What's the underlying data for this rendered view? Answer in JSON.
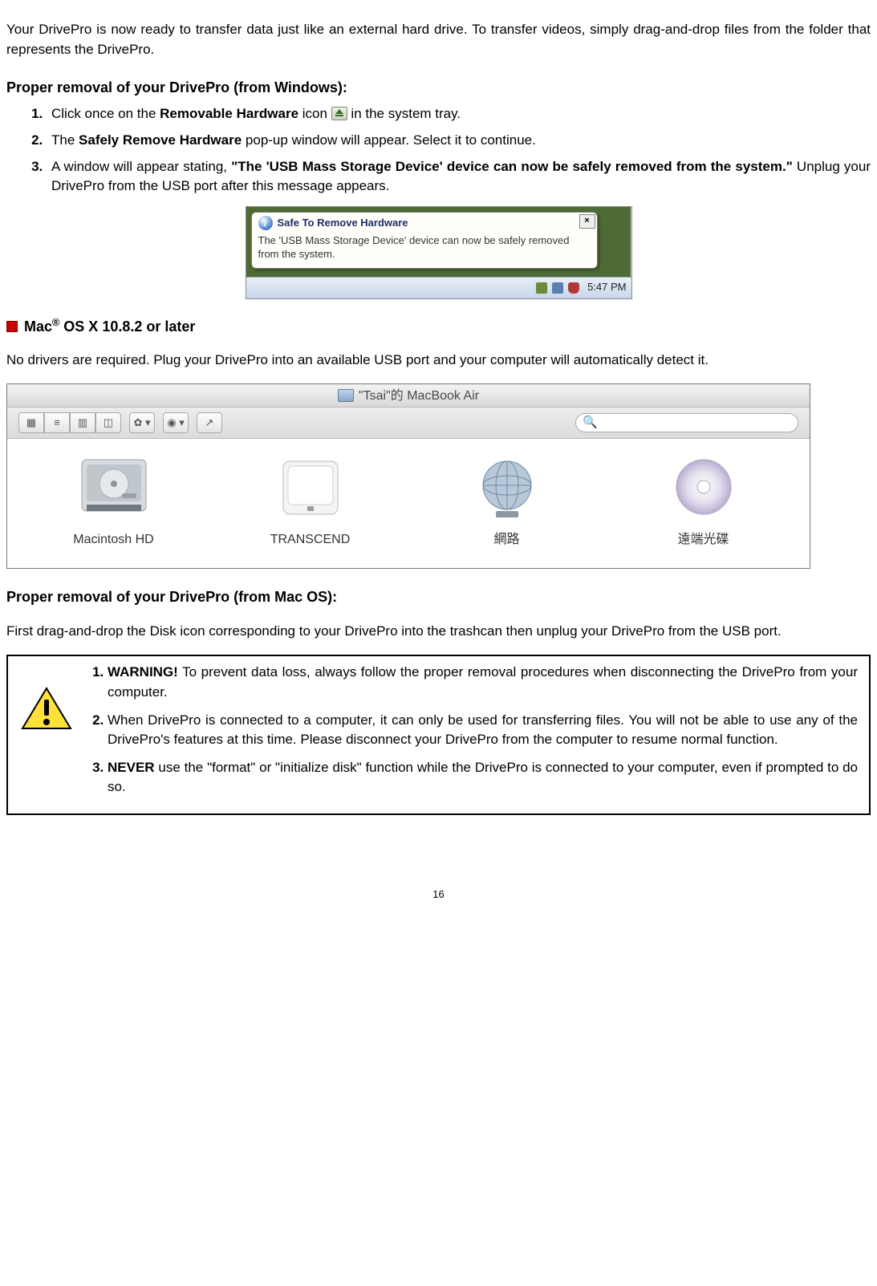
{
  "intro": "Your DrivePro is now ready to transfer data just like an external hard drive. To transfer videos, simply drag-and-drop files from the folder that represents the DrivePro.",
  "win": {
    "heading": "Proper removal of your DrivePro (from Windows):",
    "step1_a": "Click once on the ",
    "step1_b": "Removable Hardware",
    "step1_c": " icon ",
    "step1_d": " in the system tray.",
    "step2_a": "The ",
    "step2_b": "Safely Remove Hardware",
    "step2_c": " pop-up window will appear. Select it to continue.",
    "step3_a": "A window will appear stating, ",
    "step3_b": "\"The 'USB Mass Storage Device' device can now be safely removed from the system.\"",
    "step3_c": " Unplug your DrivePro from the USB port after this message appears.",
    "shot": {
      "title": "Safe To Remove Hardware",
      "body": "The 'USB Mass Storage Device' device can now be safely removed from the system.",
      "close": "×",
      "clock": "5:47 PM"
    }
  },
  "mac": {
    "heading_a": "Mac",
    "heading_b": "®",
    "heading_c": " OS X 10.8.2 or later",
    "intro": "No drivers are required. Plug your DrivePro into an available USB port and your computer will automatically detect it.",
    "finder": {
      "title": "\"Tsai\"的 MacBook Air",
      "search_glyph": "🔍",
      "gear": "✿ ▾",
      "eye": "◉ ▾",
      "share": "↗",
      "view_icons": [
        "▦",
        "≡",
        "▥",
        "◫"
      ],
      "drives": [
        {
          "label": "Macintosh HD"
        },
        {
          "label": "TRANSCEND"
        },
        {
          "label": "網路"
        },
        {
          "label": "遠端光碟"
        }
      ]
    },
    "removal_heading": "Proper removal of your DrivePro (from Mac OS):",
    "removal_body": "First drag-and-drop the Disk icon corresponding to your DrivePro into the trashcan then unplug your DrivePro from the USB port."
  },
  "warn": {
    "w1_a": "WARNING!",
    "w1_b": " To prevent data loss, always follow the proper removal procedures when disconnecting the DrivePro from your computer.",
    "w2": "When DrivePro is connected to a computer, it can only be used for transferring files. You will not be able to use any of the DrivePro's features at this time. Please disconnect your DrivePro from the computer to resume normal function.",
    "w3_a": "NEVER",
    "w3_b": " use the \"format\" or \"initialize disk\" function while the DrivePro is connected to your computer, even if prompted to do so."
  },
  "page": "16"
}
